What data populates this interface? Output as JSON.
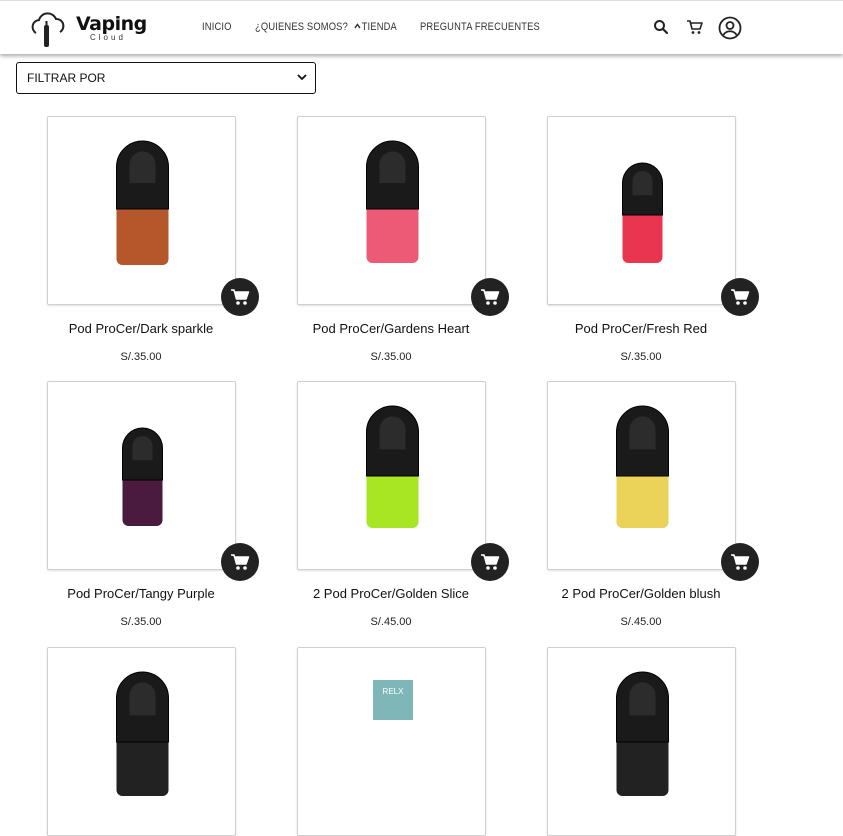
{
  "brand": {
    "name": "Vaping",
    "sub": "Cloud"
  },
  "nav": {
    "items": [
      {
        "label": "INICIO"
      },
      {
        "label": "¿QUIENES SOMOS?"
      },
      {
        "label": "TIENDA"
      },
      {
        "label": "PREGUNTA FRECUENTES"
      }
    ]
  },
  "header_icons": [
    "search-icon",
    "cart-icon",
    "user-icon"
  ],
  "filter": {
    "label": "FILTRAR POR"
  },
  "products": [
    {
      "name": "Pod ProCer/Dark sparkle",
      "price": "S/.35.00",
      "color": "#b5572a"
    },
    {
      "name": "Pod ProCer/Gardens Heart",
      "price": "S/.35.00",
      "color": "#ec5a76"
    },
    {
      "name": "Pod ProCer/Fresh Red",
      "price": "S/.35.00",
      "color": "#ea3550"
    },
    {
      "name": "Pod ProCer/Tangy Purple",
      "price": "S/.35.00",
      "color": "#4a1a3f"
    },
    {
      "name": "2 Pod ProCer/Golden Slice",
      "price": "S/.45.00",
      "color": "#a8e623"
    },
    {
      "name": "2 Pod ProCer/Golden blush",
      "price": "S/.45.00",
      "color": "#ebd35a"
    },
    {
      "name": "",
      "price": "",
      "color": "#222"
    },
    {
      "name": "",
      "price": "",
      "color": "#7fb7b9",
      "box_text": "RELX"
    },
    {
      "name": "",
      "price": "",
      "color": "#222"
    }
  ],
  "colors": {
    "accent": "#222222",
    "card_border": "#cfcfcf"
  }
}
